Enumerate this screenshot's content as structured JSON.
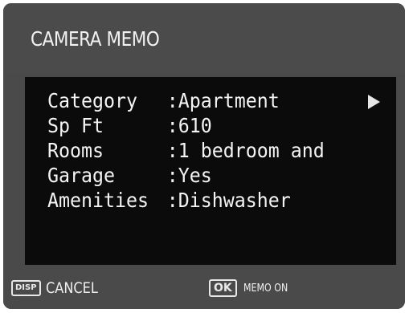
{
  "screen": {
    "title": "CAMERA MEMO"
  },
  "memo": {
    "rows": [
      {
        "label": "Category",
        "value": ":Apartment"
      },
      {
        "label": "Sp Ft",
        "value": ":610"
      },
      {
        "label": "Rooms",
        "value": ":1 bedroom and"
      },
      {
        "label": "Garage",
        "value": ":Yes"
      },
      {
        "label": "Amenities",
        "value": ":Dishwasher"
      }
    ]
  },
  "footer": {
    "disp_key": "DISP",
    "cancel_label": "CANCEL",
    "ok_key": "OK",
    "memo_on_label": "MEMO ON"
  },
  "colors": {
    "frame": "#4a4a4a",
    "panel": "#0b0b0b",
    "text": "#f4f4f4"
  }
}
